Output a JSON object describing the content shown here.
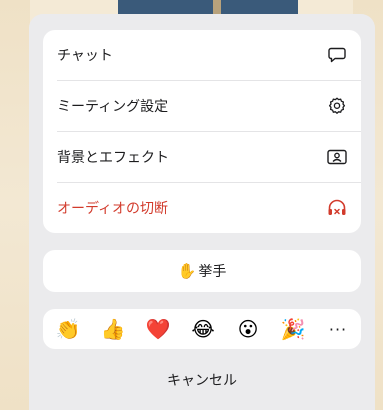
{
  "menu": {
    "items": [
      {
        "label": "チャット",
        "icon": "chat-bubble-icon",
        "danger": false
      },
      {
        "label": "ミーティング設定",
        "icon": "gear-icon",
        "danger": false
      },
      {
        "label": "背景とエフェクト",
        "icon": "background-portrait-icon",
        "danger": false
      },
      {
        "label": "オーディオの切断",
        "icon": "headphones-disconnect-icon",
        "danger": true
      }
    ]
  },
  "raise_hand": {
    "emoji": "✋",
    "label": "挙手"
  },
  "reactions": [
    {
      "emoji": "👏",
      "icon": "clapping-hands-icon"
    },
    {
      "emoji": "👍",
      "icon": "thumbs-up-icon"
    },
    {
      "emoji": "❤️",
      "icon": "red-heart-icon"
    },
    {
      "emoji": "😂",
      "icon": "tears-of-joy-icon"
    },
    {
      "emoji": "😮",
      "icon": "open-mouth-icon"
    },
    {
      "emoji": "🎉",
      "icon": "party-popper-icon"
    },
    {
      "emoji": "···",
      "icon": "more-icon"
    }
  ],
  "cancel_label": "キャンセル",
  "colors": {
    "danger": "#d23b2c",
    "sheet_bg": "#ebebed",
    "card_bg": "#ffffff"
  }
}
